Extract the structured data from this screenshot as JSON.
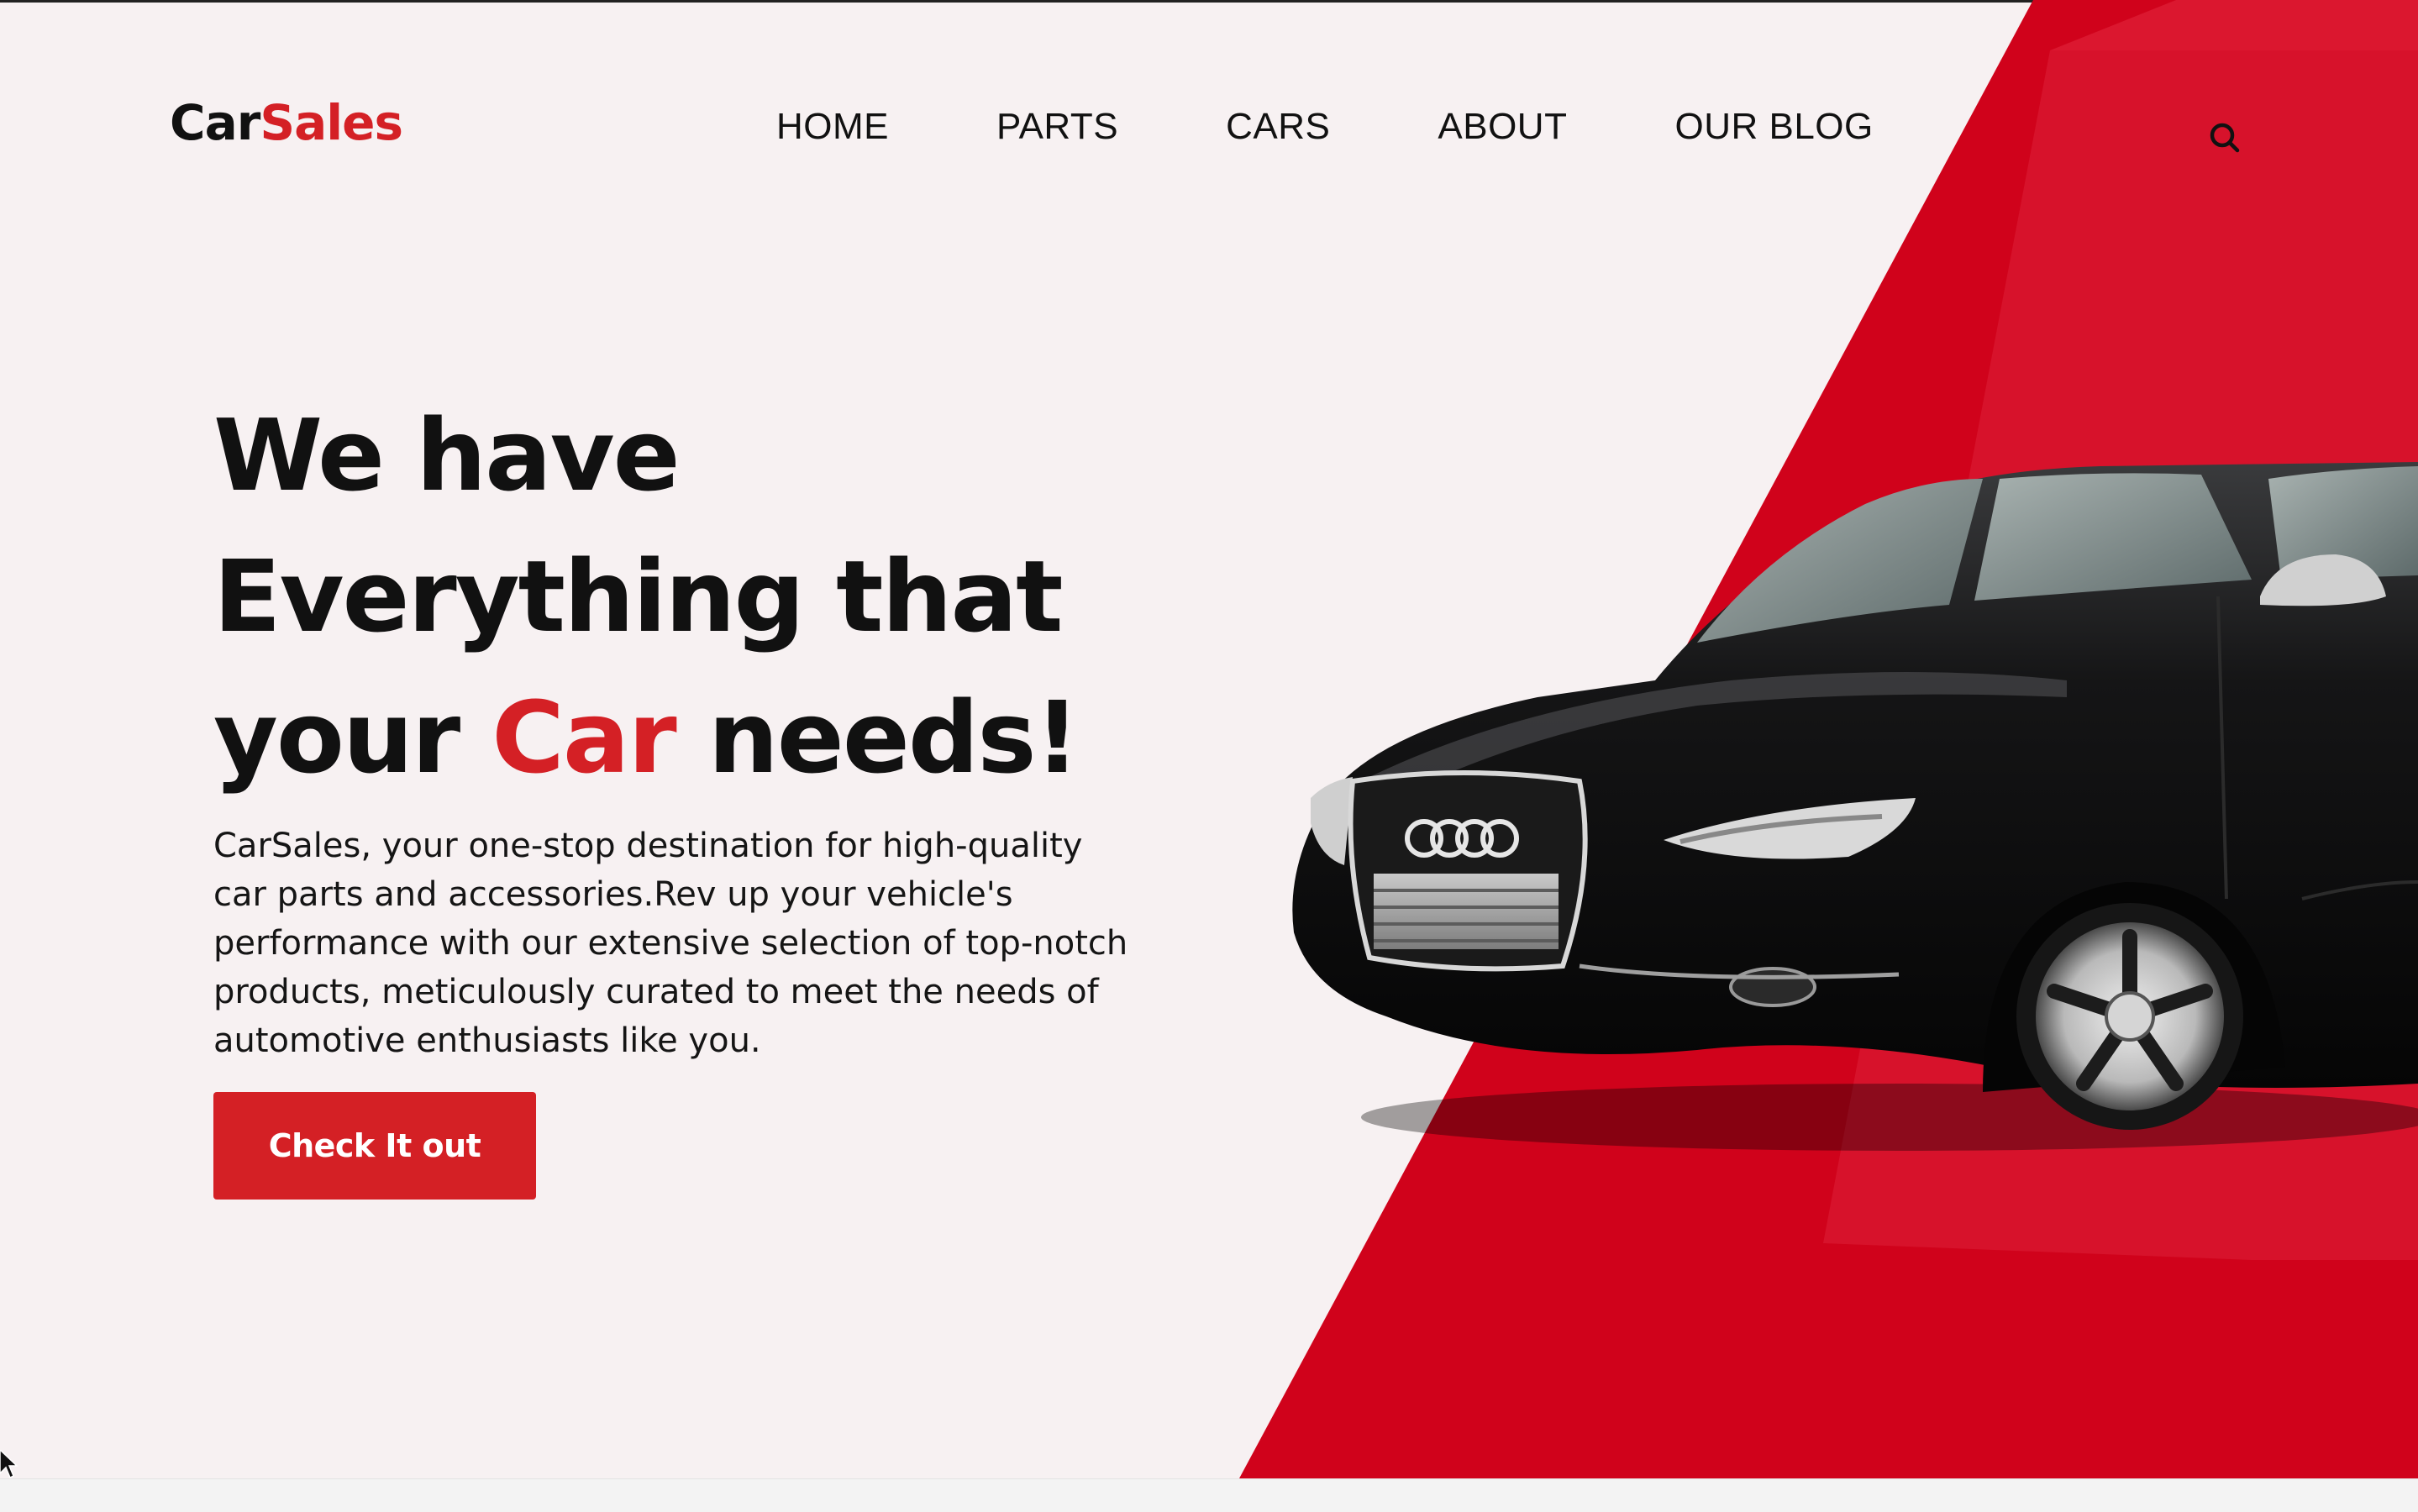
{
  "brand": {
    "name_part1": "Car",
    "name_part2": "Sales",
    "accent_color": "#d42025"
  },
  "nav": {
    "items": [
      {
        "label": "HOME"
      },
      {
        "label": "PARTS"
      },
      {
        "label": "CARS"
      },
      {
        "label": "ABOUT"
      },
      {
        "label": "OUR BLOG"
      }
    ],
    "search_icon": "search-icon"
  },
  "hero": {
    "line1": "We have",
    "line2": "Everything that",
    "line3_before": "your ",
    "line3_highlight": "Car",
    "line3_after": " needs!",
    "description": "CarSales, your one-stop destination for high-quality car parts and accessories.Rev up your vehicle's performance with our extensive selection of top-notch products, meticulously curated to meet the needs of automotive enthusiasts like you.",
    "cta_label": "Check It out"
  },
  "images": {
    "hero_image": "black-sedan-car"
  },
  "colors": {
    "background": "#f7f1f2",
    "red": "#d0021b",
    "text": "#111111"
  }
}
